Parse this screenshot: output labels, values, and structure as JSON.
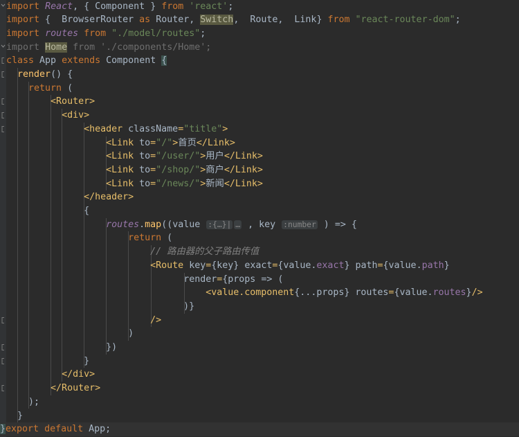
{
  "editor": {
    "app": "code-editor",
    "theme": "darcula",
    "background": "#2b2b2b",
    "gutter_background": "#313335",
    "current_line_background": "#323232",
    "font_size_px": 13.3,
    "line_height_px": 19.7,
    "colors": {
      "keyword": "#cc7832",
      "string": "#6a8759",
      "jsx_tag": "#e8bf6a",
      "property": "#9876aa",
      "function": "#ffc66d",
      "comment": "#808080",
      "plain_text": "#a9b7c6",
      "dimmed": "#6e6e6e",
      "usage_highlight": "#5a5a41",
      "brace_match": "#3b514d",
      "inlay_hint_bg": "#3b3f41",
      "indent_guide": "#4b4b4b"
    },
    "language": "javascript-jsx",
    "filename_inferred": "App.js"
  },
  "gutter": {
    "fold_markers": [
      {
        "line": 1,
        "type": "fold-end-arrow"
      },
      {
        "line": 4,
        "type": "fold-collapsed-arrow"
      },
      {
        "line": 5,
        "type": "fold-open-arrow"
      },
      {
        "line": 6,
        "type": "fold-open-arrow"
      },
      {
        "line": 8,
        "type": "fold-open-arrow"
      },
      {
        "line": 9,
        "type": "fold-open-arrow"
      },
      {
        "line": 10,
        "type": "fold-open-arrow"
      },
      {
        "line": 24,
        "type": "fold-open-arrow"
      },
      {
        "line": 26,
        "type": "fold-open-arrow"
      },
      {
        "line": 27,
        "type": "fold-open-arrow"
      },
      {
        "line": 29,
        "type": "fold-open-arrow"
      }
    ]
  },
  "code": {
    "lines": [
      {
        "n": 1,
        "indent": 0,
        "text": "import React, { Component } from 'react';"
      },
      {
        "n": 2,
        "indent": 0,
        "text": "import {  BrowserRouter as Router, Switch,  Route,  Link} from \"react-router-dom\";"
      },
      {
        "n": 3,
        "indent": 0,
        "text": "import routes from \"./model/routes\";"
      },
      {
        "n": 4,
        "indent": 0,
        "text": "import Home from './components/Home';",
        "dimmed": true
      },
      {
        "n": 5,
        "indent": 0,
        "text": "class App extends Component {"
      },
      {
        "n": 6,
        "indent": 2,
        "text": "render() {"
      },
      {
        "n": 7,
        "indent": 4,
        "text": "return ("
      },
      {
        "n": 8,
        "indent": 8,
        "text": "<Router>"
      },
      {
        "n": 9,
        "indent": 10,
        "text": "<div>"
      },
      {
        "n": 10,
        "indent": 14,
        "text": "<header className=\"title\">"
      },
      {
        "n": 11,
        "indent": 18,
        "text": "<Link to=\"/\">首页</Link>"
      },
      {
        "n": 12,
        "indent": 18,
        "text": "<Link to=\"/user/\">用户</Link>"
      },
      {
        "n": 13,
        "indent": 18,
        "text": "<Link to=\"/shop/\">商户</Link>"
      },
      {
        "n": 14,
        "indent": 18,
        "text": "<Link to=\"/news/\">新闻</Link>"
      },
      {
        "n": 15,
        "indent": 14,
        "text": "</header>"
      },
      {
        "n": 16,
        "indent": 14,
        "text": "{"
      },
      {
        "n": 17,
        "indent": 18,
        "text": "routes.map((value :{…}| … , key :number ) => {"
      },
      {
        "n": 18,
        "indent": 22,
        "text": "return ("
      },
      {
        "n": 19,
        "indent": 26,
        "text": "// 路由器的父子路由传值"
      },
      {
        "n": 20,
        "indent": 26,
        "text": "<Route key={key} exact={value.exact} path={value.path}"
      },
      {
        "n": 21,
        "indent": 32,
        "text": "render={props => ("
      },
      {
        "n": 22,
        "indent": 36,
        "text": "<value.component{...props} routes={value.routes}/>"
      },
      {
        "n": 23,
        "indent": 32,
        "text": ")}"
      },
      {
        "n": 24,
        "indent": 26,
        "text": "/>"
      },
      {
        "n": 25,
        "indent": 22,
        "text": ")"
      },
      {
        "n": 26,
        "indent": 18,
        "text": "})"
      },
      {
        "n": 27,
        "indent": 14,
        "text": "}"
      },
      {
        "n": 28,
        "indent": 10,
        "text": "</div>"
      },
      {
        "n": 29,
        "indent": 8,
        "text": "</Router>"
      },
      {
        "n": 30,
        "indent": 4,
        "text": ");"
      },
      {
        "n": 31,
        "indent": 2,
        "text": "}"
      },
      {
        "n": 32,
        "indent": 0,
        "text": "export default App;",
        "current_line": true
      }
    ],
    "inlay_hints": [
      {
        "line": 17,
        "text": ":{…}|"
      },
      {
        "line": 17,
        "text": "…"
      },
      {
        "line": 17,
        "text": ":number"
      }
    ],
    "usage_highlights": [
      {
        "line": 2,
        "token": "Switch"
      },
      {
        "line": 4,
        "token": "Home"
      }
    ],
    "brace_matches": [
      {
        "line": 5,
        "token": "{"
      },
      {
        "line": 32,
        "token": "}"
      }
    ],
    "comments": [
      {
        "line": 19,
        "text": "// 路由器的父子路由传值"
      }
    ],
    "strings": [
      "'react'",
      "\"react-router-dom\"",
      "\"./model/routes\"",
      "'./components/Home'",
      "\"title\"",
      "\"/\"",
      "\"/user/\"",
      "\"/shop/\"",
      "\"/news/\""
    ],
    "cjk_link_labels": [
      "首页",
      "用户",
      "商户",
      "新闻"
    ]
  }
}
